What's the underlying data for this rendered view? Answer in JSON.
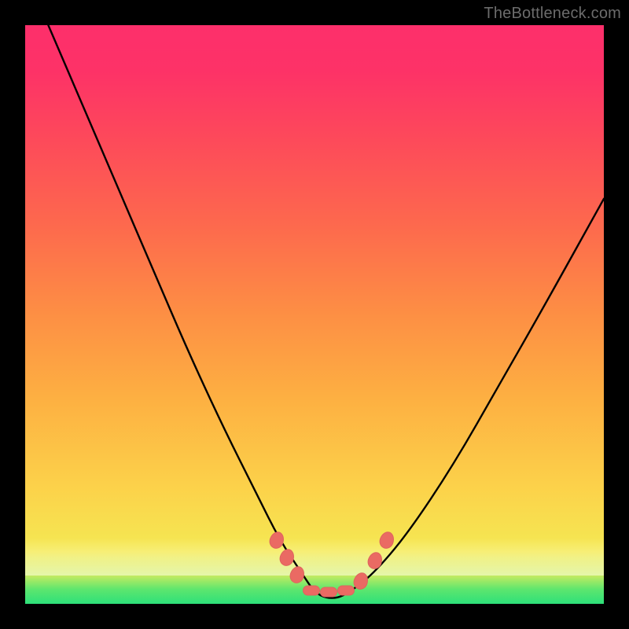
{
  "watermark": "TheBottleneck.com",
  "colors": {
    "marker": "#ea6a63",
    "curve": "#000000",
    "frame": "#000000"
  },
  "chart_data": {
    "type": "line",
    "title": "",
    "xlabel": "",
    "ylabel": "",
    "xlim": [
      0,
      100
    ],
    "ylim": [
      0,
      100
    ],
    "grid": false,
    "series": [
      {
        "name": "bottleneck-curve",
        "x": [
          4,
          10,
          16,
          22,
          28,
          34,
          40,
          44,
          48,
          50,
          52,
          54,
          56,
          60,
          66,
          74,
          82,
          90,
          100
        ],
        "y": [
          100,
          86,
          72,
          58,
          44,
          31,
          19,
          11,
          5,
          2,
          1,
          1,
          2,
          5,
          12,
          24,
          38,
          52,
          70
        ]
      }
    ],
    "markers": [
      {
        "x": 43.5,
        "y": 11.0,
        "shape": "oval"
      },
      {
        "x": 45.2,
        "y": 8.0,
        "shape": "oval"
      },
      {
        "x": 47.0,
        "y": 5.0,
        "shape": "oval"
      },
      {
        "x": 49.5,
        "y": 2.3,
        "shape": "flat"
      },
      {
        "x": 52.5,
        "y": 2.0,
        "shape": "flat"
      },
      {
        "x": 55.5,
        "y": 2.3,
        "shape": "flat"
      },
      {
        "x": 58.0,
        "y": 4.0,
        "shape": "oval"
      },
      {
        "x": 60.5,
        "y": 7.5,
        "shape": "oval"
      },
      {
        "x": 62.5,
        "y": 11.0,
        "shape": "oval"
      }
    ]
  }
}
